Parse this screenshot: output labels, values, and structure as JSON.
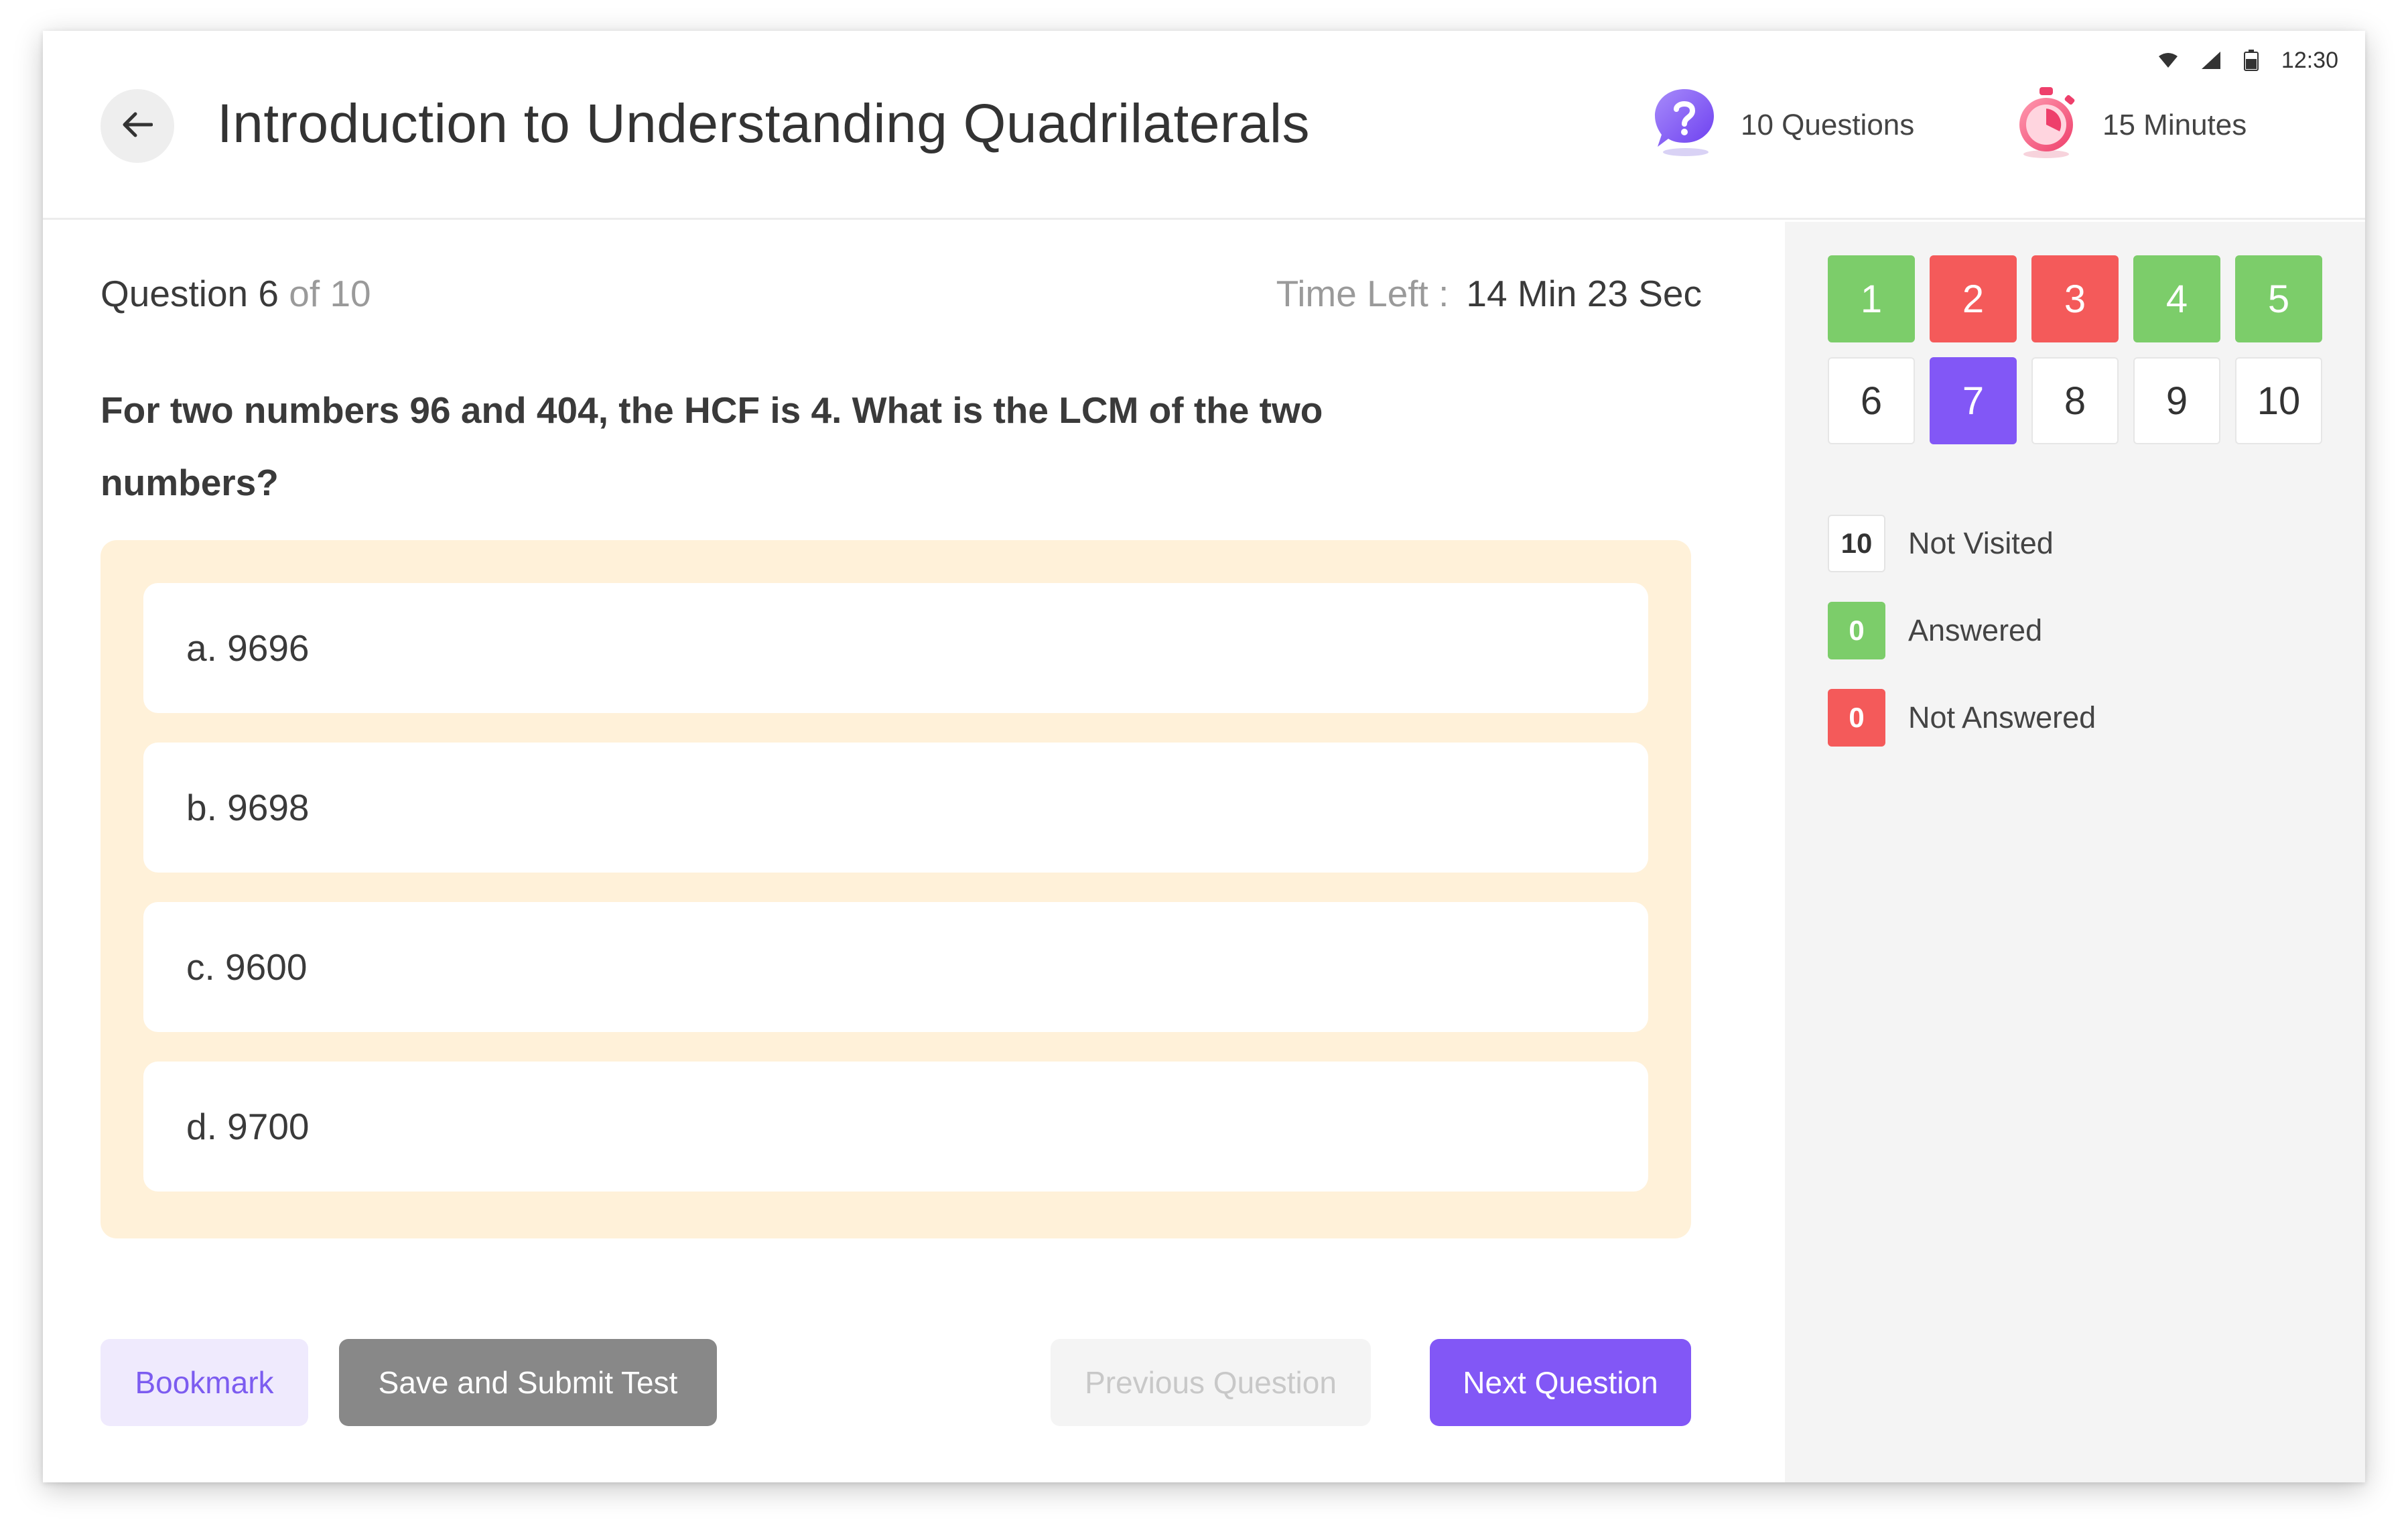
{
  "status_bar": {
    "time": "12:30"
  },
  "header": {
    "title": "Introduction to Understanding Quadrilaterals",
    "questions_label": "10 Questions",
    "minutes_label": "15 Minutes"
  },
  "question": {
    "label": "Question",
    "current": "6",
    "of_total": "of 10",
    "time_left_label": "Time Left :",
    "time_left_value": "14 Min 23 Sec",
    "text": "For two numbers 96 and 404, the HCF is 4. What is the LCM of the two numbers?",
    "options": [
      {
        "label": "a. 9696"
      },
      {
        "label": "b. 9698"
      },
      {
        "label": "c. 9600"
      },
      {
        "label": "d. 9700"
      }
    ]
  },
  "buttons": {
    "bookmark": "Bookmark",
    "submit": "Save and Submit Test",
    "previous": "Previous Question",
    "next": "Next Question"
  },
  "palette": {
    "cells": [
      {
        "num": "1",
        "state": "answered"
      },
      {
        "num": "2",
        "state": "not-answered"
      },
      {
        "num": "3",
        "state": "not-answered"
      },
      {
        "num": "4",
        "state": "answered"
      },
      {
        "num": "5",
        "state": "answered"
      },
      {
        "num": "6",
        "state": "not-visited"
      },
      {
        "num": "7",
        "state": "current"
      },
      {
        "num": "8",
        "state": "not-visited"
      },
      {
        "num": "9",
        "state": "not-visited"
      },
      {
        "num": "10",
        "state": "not-visited"
      }
    ],
    "legend": [
      {
        "count": "10",
        "label": "Not Visited"
      },
      {
        "count": "0",
        "label": "Answered"
      },
      {
        "count": "0",
        "label": "Not Answered"
      }
    ]
  },
  "colors": {
    "accent": "#8257f6",
    "answered": "#7ccd6a",
    "not_answered": "#f45a5a",
    "options_bg": "#fff1d9"
  },
  "icons": {
    "back": "arrow-left-icon",
    "questions": "question-mark-icon",
    "timer": "stopwatch-icon",
    "wifi": "wifi-icon",
    "signal": "signal-icon",
    "battery": "battery-icon"
  }
}
